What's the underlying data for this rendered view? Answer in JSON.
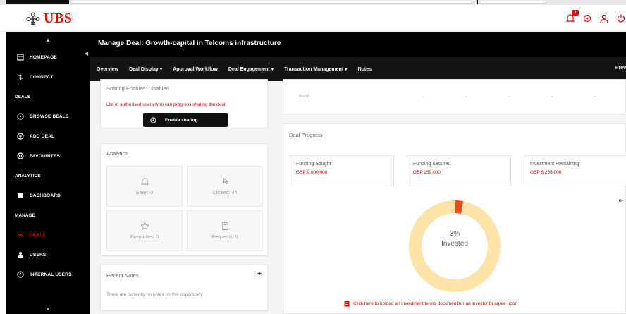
{
  "header": {
    "brand": "UBS",
    "notification_count": "1"
  },
  "sidebar": {
    "items": [
      {
        "label": "HOMEPAGE",
        "icon": "home-icon"
      },
      {
        "label": "CONNECT",
        "icon": "connect-icon"
      },
      {
        "section": "DEALS"
      },
      {
        "label": "BROWSE DEALS",
        "icon": "browse-icon"
      },
      {
        "label": "ADD DEAL",
        "icon": "add-icon"
      },
      {
        "label": "FAVOURITES",
        "icon": "star-icon"
      },
      {
        "section": "ANALYTICS"
      },
      {
        "label": "DASHBOARD",
        "icon": "dashboard-icon"
      },
      {
        "section": "MANAGE"
      },
      {
        "label": "DEALS",
        "icon": "deals-icon",
        "active": true
      },
      {
        "label": "USERS",
        "icon": "users-icon"
      },
      {
        "label": "INTERNAL USERS",
        "icon": "internal-users-icon"
      }
    ]
  },
  "page": {
    "title": "Manage Deal: Growth-capital in Telcoms infrastructure"
  },
  "nav": {
    "tabs": [
      "Overview",
      "Deal Display ▾",
      "Approval Workflow",
      "Deal Engagement ▾",
      "Transaction Management ▾",
      "Notes"
    ],
    "right": "Prev"
  },
  "sharing": {
    "title": "Sharing Enabled: Disabled",
    "warning": "List of authorised users who can progress sharing the deal",
    "button": "Enable sharing"
  },
  "analytics": {
    "title": "Analytics",
    "stats": [
      {
        "label": "Seen: 0",
        "icon": "bell-icon"
      },
      {
        "label": "Clicked: 44",
        "icon": "click-icon"
      },
      {
        "label": "Favourites: 0",
        "icon": "star-icon"
      },
      {
        "label": "Requests: 0",
        "icon": "document-icon"
      }
    ]
  },
  "notes": {
    "title": "Recent Notes",
    "plus": "+",
    "empty": "There are currently no notes on this opportunity"
  },
  "top_row": {
    "first": "Bond",
    "cells": [
      "-",
      "-",
      "-",
      "-",
      "-"
    ]
  },
  "progress": {
    "title": "Deal Progress",
    "metrics": [
      {
        "label": "Funding Sought",
        "value": "GBP 9,000,000"
      },
      {
        "label": "Funding Secured",
        "value": "GBP 259,000"
      },
      {
        "label": "Investment Remaining",
        "value": "GBP 8,255,000"
      }
    ],
    "percent_label": "3%",
    "invested_label": "Invested",
    "invested_fraction": 0.03,
    "colors": {
      "remaining": "#fde3a7",
      "invested": "#e8481c"
    },
    "upload_link": "Click here to upload an investment terms document for an investor to agree upon"
  }
}
